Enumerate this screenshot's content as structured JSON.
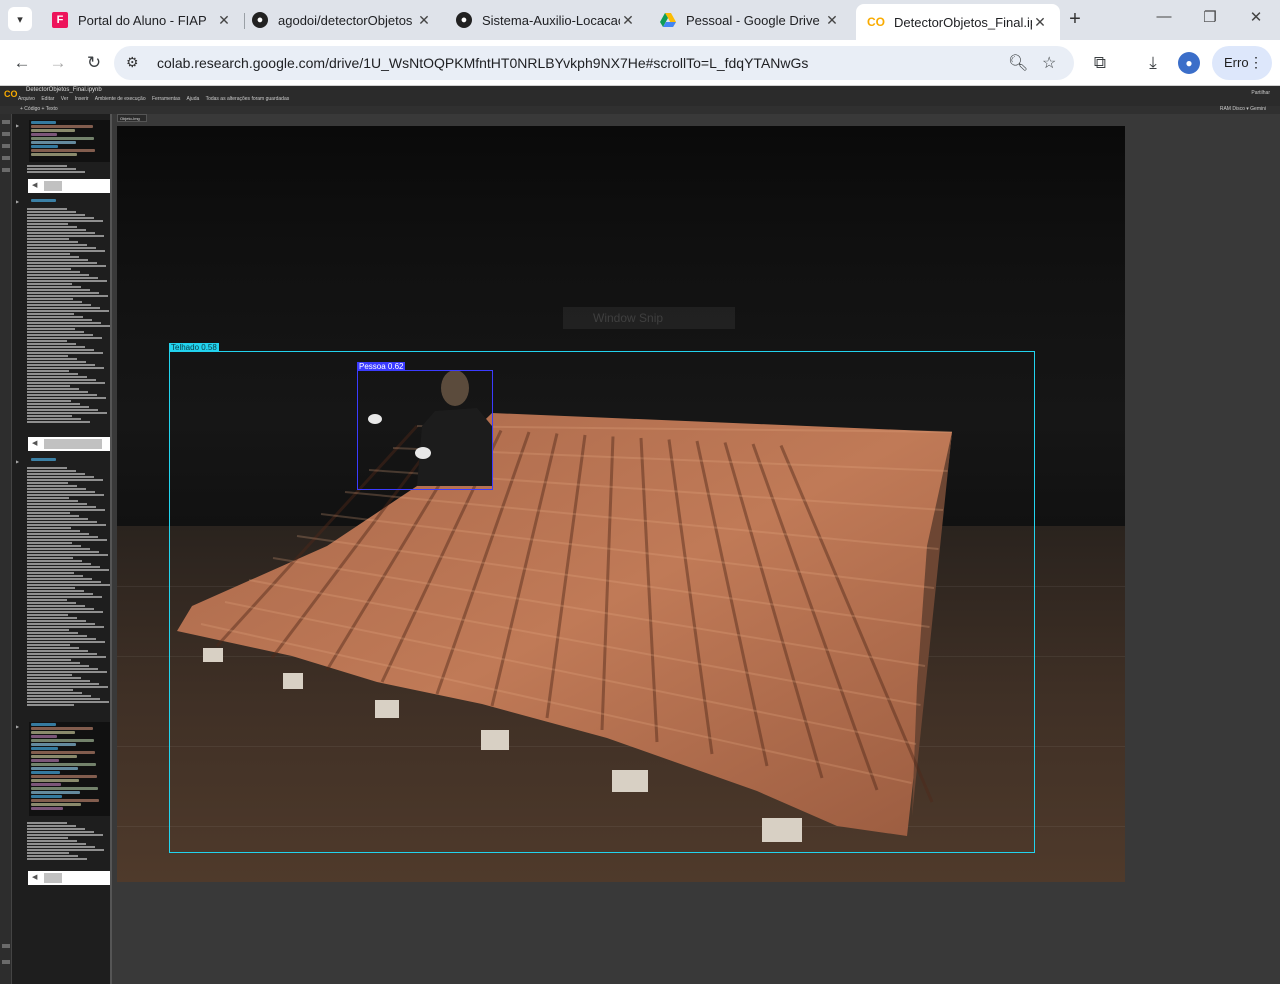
{
  "browser": {
    "tabs": [
      {
        "title": "Portal do Aluno - FIAP",
        "icon": "fiap-icon"
      },
      {
        "title": "agodoi/detectorObjetos",
        "icon": "github-icon"
      },
      {
        "title": "Sistema-Auxilio-Locacao",
        "icon": "github-icon"
      },
      {
        "title": "Pessoal - Google Drive",
        "icon": "google-drive-icon"
      },
      {
        "title": "DetectorObjetos_Final.ipynb",
        "icon": "colab-icon",
        "active": true
      }
    ],
    "url": "colab.research.google.com/drive/1U_WsNtOQPKMfntHT0NRLBYvkph9NX7He#scrollTo=L_fdqYTANwGs",
    "profile_button_label": "Erro"
  },
  "colab": {
    "logo": "CO",
    "notebook_title": "DetectorObjetos_Final.ipynb",
    "menus": [
      "Arquivo",
      "Editar",
      "Ver",
      "Inserir",
      "Ambiente de execução",
      "Ferramentas",
      "Ajuda",
      "Todas as alterações foram guardadas"
    ],
    "header_right": "Partilhar",
    "toolbar_left": "+ Código   + Texto",
    "toolbar_right": "RAM  Disco  ▾  Gemini",
    "output_tab": "Objeto-Img"
  },
  "detection": {
    "ghost_overlay": "Window Snip",
    "boxes": [
      {
        "label": "Telhado  0.58",
        "color": "#22d3ee"
      },
      {
        "label": "Pessoa  0.62",
        "color": "#3b3bff"
      }
    ]
  },
  "colors": {
    "colab_bg": "#393939",
    "accent_orange": "#f9ab00",
    "telhado_box": "#22d3ee",
    "pessoa_box": "#3b3bff",
    "roof_tile": "#b7714f"
  }
}
